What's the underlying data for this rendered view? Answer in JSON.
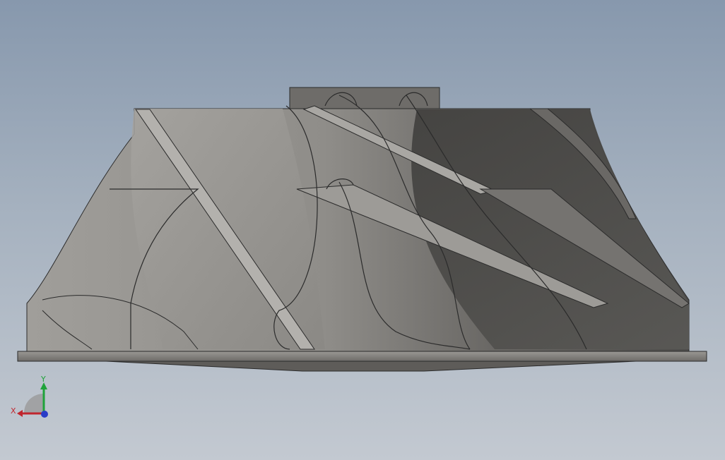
{
  "viewport": {
    "background_top": "#8798ad",
    "background_bottom": "#c3c9d1"
  },
  "model": {
    "description_icon": "impeller-3d-model",
    "body_color": "#8e8c88",
    "shadow_color": "#4f4e4c",
    "edge_color": "#2b2b2b"
  },
  "triad": {
    "x_label": "X",
    "y_label": "Y",
    "x_color": "#c0262e",
    "y_color": "#1fa33a",
    "z_color": "#2a3cc7"
  }
}
